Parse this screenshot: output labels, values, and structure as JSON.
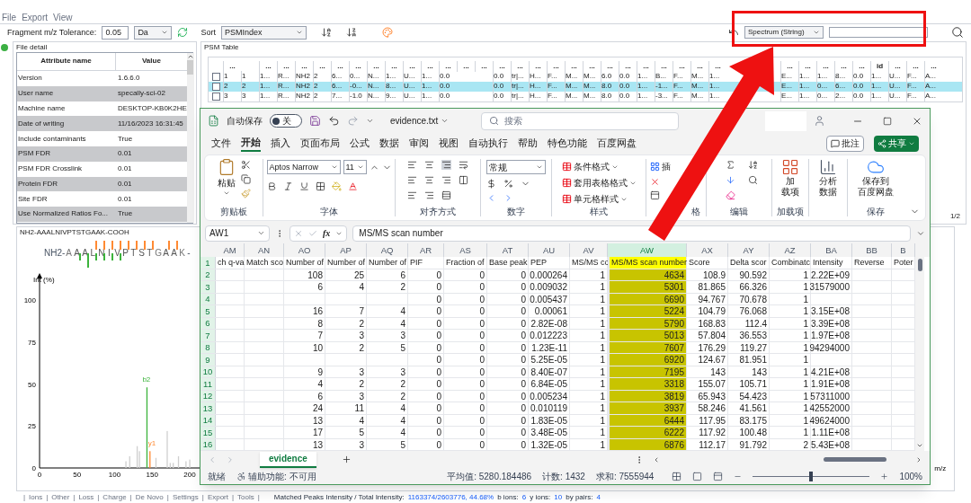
{
  "menu": [
    "File",
    "Export",
    "View"
  ],
  "toolbar": {
    "tolerance_label": "Fragment m/z Tolerance:",
    "tolerance": "0.05",
    "unit": "Da",
    "sort_label": "Sort",
    "sort": "PSMIndex",
    "search_type": "Spectrum (String)"
  },
  "file_detail": {
    "title": "File detail",
    "columns": [
      "Attribute name",
      "Value"
    ],
    "rows": [
      {
        "name": "Version",
        "value": "1.6.6.0"
      },
      {
        "name": "User name",
        "value": "specally-sci-02"
      },
      {
        "name": "Machine name",
        "value": "DESKTOP-KB0K2HE"
      },
      {
        "name": "Date of writing",
        "value": "11/16/2023 16:31:45"
      },
      {
        "name": "Include contaminants",
        "value": "True"
      },
      {
        "name": "PSM FDR",
        "value": "0.01"
      },
      {
        "name": "PSM FDR Crosslink",
        "value": "0.01"
      },
      {
        "name": "Protein FDR",
        "value": "0.01"
      },
      {
        "name": "Site FDR",
        "value": "0.01"
      },
      {
        "name": "Use Normalized Ratios Fo...",
        "value": "True"
      }
    ]
  },
  "psm_table": {
    "title": "PSM Table",
    "page": "1/2",
    "columns": [
      "...",
      "",
      "...",
      "...",
      "...",
      "...",
      "...",
      "...",
      "...",
      "...",
      "...",
      "...",
      "...",
      "...",
      "...",
      "...",
      "...",
      "...",
      "...",
      "...",
      "...",
      "...",
      "...",
      "...",
      "...",
      "...",
      "...",
      "...",
      "",
      "",
      "",
      "...",
      "...",
      "...",
      "...",
      "...",
      "id",
      "...",
      "...",
      "..."
    ],
    "rows": [
      {
        "checked": false,
        "cells": [
          "1",
          "1",
          "1...",
          "R...",
          "NH2",
          "2",
          "6...",
          "0...",
          "N...",
          "1...",
          "U...",
          "1...",
          "0.0",
          "",
          "",
          "0.0",
          "tr|...",
          "H...",
          "F...",
          "M...",
          "M...",
          "6.0",
          "0.0",
          "1...",
          "B...",
          "F...",
          "M...",
          "1...",
          "",
          "",
          "",
          "E...",
          "1...",
          "1...",
          "8...",
          "0.0",
          "1...",
          "U...",
          "F...",
          "A..."
        ]
      },
      {
        "checked": false,
        "cells": [
          "2",
          "2",
          "1...",
          "R...",
          "NH2",
          "2",
          "6...",
          "-0...",
          "N...",
          "8...",
          "U...",
          "1...",
          "0.0",
          "",
          "",
          "0.0",
          "tr|...",
          "H...",
          "F...",
          "M...",
          "M...",
          "8.0",
          "0.0",
          "1...",
          "-1...",
          "F...",
          "M...",
          "1...",
          "",
          "",
          "",
          "E...",
          "1...",
          "0...",
          "6...",
          "0.0",
          "1...",
          "U...",
          "F...",
          "A..."
        ]
      },
      {
        "checked": false,
        "cells": [
          "3",
          "3",
          "1...",
          "R...",
          "NH2",
          "2",
          "7...",
          "-1.0",
          "N...",
          "9...",
          "U...",
          "1...",
          "0.0",
          "",
          "",
          "0.0",
          "tr|...",
          "H...",
          "F...",
          "M...",
          "M...",
          "8.0",
          "0.0",
          "1...",
          "-3...",
          "F...",
          "M...",
          "1...",
          "",
          "",
          "",
          "E...",
          "1...",
          "0...",
          "2...",
          "0.0",
          "1...",
          "U...",
          "F...",
          "A..."
        ]
      }
    ]
  },
  "spectrum": {
    "title": "NH2-AAALNIVPTSTGAAK-COOH",
    "prefix": "NH2-",
    "suffix": "-",
    "residues": [
      {
        "aa": "A",
        "b_mark": false,
        "y_mark": false
      },
      {
        "aa": "A",
        "b_mark": true,
        "y_mark": false
      },
      {
        "aa": "A",
        "b_mark": true,
        "y_mark": false
      },
      {
        "aa": "L",
        "b_mark": true,
        "y_mark": true
      },
      {
        "aa": "N",
        "b_mark": true,
        "y_mark": true
      },
      {
        "aa": "I",
        "b_mark": true,
        "y_mark": true
      },
      {
        "aa": "V",
        "b_mark": true,
        "y_mark": true
      },
      {
        "aa": "P",
        "b_mark": false,
        "y_mark": true
      },
      {
        "aa": "T",
        "b_mark": false,
        "y_mark": true
      },
      {
        "aa": "S",
        "b_mark": false,
        "y_mark": true
      },
      {
        "aa": "T",
        "b_mark": false,
        "y_mark": true
      },
      {
        "aa": "G",
        "b_mark": false,
        "y_mark": false
      },
      {
        "aa": "A",
        "b_mark": false,
        "y_mark": true
      },
      {
        "aa": "A",
        "b_mark": false,
        "y_mark": true
      },
      {
        "aa": "K",
        "b_mark": false,
        "y_mark": false
      }
    ],
    "peak_labels": [
      {
        "text": "b2",
        "kind": "b"
      },
      {
        "text": "y1",
        "kind": "y"
      }
    ],
    "chart_data": {
      "type": "bar",
      "xlabel": "m/z",
      "ylabel": "Int (%)",
      "x": [
        115,
        120,
        130,
        133,
        143,
        147,
        155,
        170,
        174,
        178,
        185,
        195,
        200
      ],
      "series": [
        {
          "color": "#3cb43c",
          "values": [
            null,
            null,
            null,
            null,
            48,
            null,
            null,
            null,
            null,
            null,
            null,
            null,
            null
          ]
        },
        {
          "color": "#ff8a33",
          "values": [
            null,
            null,
            null,
            null,
            null,
            10,
            null,
            null,
            null,
            null,
            null,
            null,
            null
          ]
        },
        {
          "color": "#cfcfcf",
          "values": [
            4,
            7,
            13,
            10,
            null,
            null,
            6,
            22,
            3,
            3,
            7,
            4,
            5
          ]
        }
      ],
      "xlim": [
        0,
        1186
      ],
      "ylim": [
        0,
        115
      ],
      "xticks": [
        0,
        50,
        100,
        150,
        200
      ],
      "yticks": [
        0,
        25,
        50,
        75,
        100
      ]
    }
  },
  "bottom_bar": {
    "separator": "|",
    "tabs": [
      "Ions",
      "Other",
      "Loss",
      "Charge",
      "De Novo",
      "Settings",
      "Export",
      "Tools"
    ],
    "summary": [
      {
        "kind": "label",
        "text": "Matched Peaks Intensity / Total Intensity:"
      },
      {
        "kind": "value",
        "text": "1163374/2603776, 44.68%"
      },
      {
        "kind": "label",
        "text": "b ions:"
      },
      {
        "kind": "value",
        "text": "6"
      },
      {
        "kind": "label",
        "text": "y ions:"
      },
      {
        "kind": "value",
        "text": "10"
      },
      {
        "kind": "label",
        "text": "by pairs:"
      },
      {
        "kind": "value",
        "text": "4"
      }
    ]
  },
  "excel": {
    "autosave": {
      "label": "自动保存",
      "on": false,
      "state_text": "关"
    },
    "filename": "evidence.txt",
    "search_placeholder": "搜索",
    "tabs": [
      {
        "label": "文件",
        "selected": false
      },
      {
        "label": "开始",
        "selected": true
      },
      {
        "label": "插入",
        "selected": false
      },
      {
        "label": "页面布局",
        "selected": false
      },
      {
        "label": "公式",
        "selected": false
      },
      {
        "label": "数据",
        "selected": false
      },
      {
        "label": "审阅",
        "selected": false
      },
      {
        "label": "视图",
        "selected": false
      },
      {
        "label": "自动执行",
        "selected": false
      },
      {
        "label": "帮助",
        "selected": false
      },
      {
        "label": "特色功能",
        "selected": false
      },
      {
        "label": "百度网盘",
        "selected": false
      }
    ],
    "comment_button": "批注",
    "share_button": "共享",
    "ribbon": [
      {
        "kind": "clipboard",
        "label": "剪贴板",
        "button": "粘贴"
      },
      {
        "kind": "font",
        "label": "字体",
        "font": "Aptos Narrow",
        "size": "11"
      },
      {
        "kind": "alignment",
        "label": "对齐方式"
      },
      {
        "kind": "number",
        "label": "数字",
        "format": "常规"
      },
      {
        "kind": "styles",
        "label": "样式",
        "items": [
          "条件格式",
          "套用表格格式",
          "单元格样式"
        ]
      },
      {
        "kind": "cells",
        "label": "格",
        "items": [
          "插"
        ]
      },
      {
        "kind": "editing",
        "label": "编辑"
      },
      {
        "kind": "addins",
        "label": "加载项",
        "button": [
          "加",
          "载项"
        ]
      },
      {
        "kind": "analysis",
        "button": [
          "分析",
          "数据"
        ]
      },
      {
        "kind": "save",
        "label": "保存",
        "button": [
          "保存到",
          "百度网盘"
        ]
      }
    ],
    "name_box": "AW1",
    "function_label": "fx",
    "formula": "MS/MS scan number",
    "columns": [
      {
        "label": "AM",
        "selected": false
      },
      {
        "label": "AN",
        "selected": false
      },
      {
        "label": "AO",
        "selected": false
      },
      {
        "label": "AP",
        "selected": false
      },
      {
        "label": "AQ",
        "selected": false
      },
      {
        "label": "AR",
        "selected": false
      },
      {
        "label": "AS",
        "selected": false
      },
      {
        "label": "AT",
        "selected": false
      },
      {
        "label": "AU",
        "selected": false
      },
      {
        "label": "AV",
        "selected": false
      },
      {
        "label": "AW",
        "selected": true
      },
      {
        "label": "AX",
        "selected": false
      },
      {
        "label": "AY",
        "selected": false
      },
      {
        "label": "AZ",
        "selected": false
      },
      {
        "label": "BA",
        "selected": false
      },
      {
        "label": "BB",
        "selected": false
      },
      {
        "label": "B",
        "selected": false
      }
    ],
    "rows": [
      {
        "number": "1",
        "cells": [
          "ch q-va",
          "Match sco",
          "Number of",
          "Number of",
          "Number of",
          "PIF",
          "Fraction of",
          "Base peak",
          "PEP",
          "MS/MS co",
          "MS/MS scan number",
          "Score",
          "Delta scor",
          "Combinatc",
          "Intensity",
          "Reverse",
          "Poter"
        ]
      },
      {
        "number": "2",
        "cells": [
          "",
          "",
          "108",
          "25",
          "6",
          "0",
          "0",
          "0",
          "0.000264",
          "1",
          "4634",
          "108.9",
          "90.592",
          "1",
          "2.22E+09",
          "",
          ""
        ]
      },
      {
        "number": "3",
        "cells": [
          "",
          "",
          "6",
          "4",
          "2",
          "0",
          "0",
          "0",
          "0.009032",
          "1",
          "5301",
          "81.865",
          "66.326",
          "1",
          "31579000",
          "",
          ""
        ]
      },
      {
        "number": "4",
        "cells": [
          "",
          "",
          "",
          "",
          "",
          "0",
          "0",
          "0",
          "0.005437",
          "1",
          "6690",
          "94.767",
          "70.678",
          "1",
          "",
          "",
          ""
        ]
      },
      {
        "number": "5",
        "cells": [
          "",
          "",
          "16",
          "7",
          "4",
          "0",
          "0",
          "0",
          "0.00061",
          "1",
          "5224",
          "104.79",
          "76.068",
          "1",
          "3.15E+08",
          "",
          ""
        ]
      },
      {
        "number": "6",
        "cells": [
          "",
          "",
          "8",
          "2",
          "4",
          "0",
          "0",
          "0",
          "2.82E-08",
          "1",
          "5790",
          "168.83",
          "112.4",
          "1",
          "3.39E+08",
          "",
          ""
        ]
      },
      {
        "number": "7",
        "cells": [
          "",
          "",
          "7",
          "3",
          "3",
          "0",
          "0",
          "0",
          "0.012223",
          "1",
          "5013",
          "57.804",
          "36.553",
          "1",
          "1.97E+08",
          "",
          ""
        ]
      },
      {
        "number": "8",
        "cells": [
          "",
          "",
          "10",
          "2",
          "5",
          "0",
          "0",
          "0",
          "1.23E-11",
          "1",
          "7607",
          "176.29",
          "119.27",
          "1",
          "94294000",
          "",
          ""
        ]
      },
      {
        "number": "9",
        "cells": [
          "",
          "",
          "",
          "",
          "",
          "0",
          "0",
          "0",
          "5.25E-05",
          "1",
          "6920",
          "124.67",
          "81.951",
          "1",
          "",
          "",
          ""
        ]
      },
      {
        "number": "10",
        "cells": [
          "",
          "",
          "9",
          "3",
          "3",
          "0",
          "0",
          "0",
          "8.40E-07",
          "1",
          "7195",
          "143",
          "143",
          "1",
          "4.21E+08",
          "",
          ""
        ]
      },
      {
        "number": "11",
        "cells": [
          "",
          "",
          "4",
          "2",
          "2",
          "0",
          "0",
          "0",
          "6.84E-05",
          "1",
          "3318",
          "155.07",
          "105.71",
          "1",
          "1.91E+08",
          "",
          ""
        ]
      },
      {
        "number": "12",
        "cells": [
          "",
          "",
          "6",
          "3",
          "2",
          "0",
          "0",
          "0",
          "0.005234",
          "1",
          "3819",
          "65.943",
          "54.423",
          "1",
          "57311000",
          "",
          ""
        ]
      },
      {
        "number": "13",
        "cells": [
          "",
          "",
          "24",
          "11",
          "4",
          "0",
          "0",
          "0",
          "0.010119",
          "1",
          "3937",
          "58.246",
          "41.561",
          "1",
          "42552000",
          "",
          ""
        ]
      },
      {
        "number": "14",
        "cells": [
          "",
          "",
          "13",
          "4",
          "4",
          "0",
          "0",
          "0",
          "1.83E-05",
          "1",
          "6444",
          "117.95",
          "83.175",
          "1",
          "49624000",
          "",
          ""
        ]
      },
      {
        "number": "15",
        "cells": [
          "",
          "",
          "17",
          "5",
          "4",
          "0",
          "0",
          "0",
          "3.48E-05",
          "1",
          "6222",
          "117.92",
          "100.48",
          "1",
          "1.11E+08",
          "",
          ""
        ]
      },
      {
        "number": "16",
        "cells": [
          "",
          "",
          "13",
          "3",
          "5",
          "0",
          "0",
          "0",
          "1.32E-05",
          "1",
          "6876",
          "112.17",
          "91.792",
          "2",
          "5.43E+08",
          "",
          ""
        ]
      }
    ],
    "sheet_tabs": [
      {
        "label": "evidence",
        "selected": true
      }
    ],
    "status": {
      "ready": "就绪",
      "accessibility": "辅助功能: 不可用",
      "average": "平均值: 5280.184486",
      "count": "计数: 1432",
      "sum": "求和: 7555944",
      "zoom": "100%",
      "zoom_slider": {
        "level": 0.5
      }
    }
  }
}
